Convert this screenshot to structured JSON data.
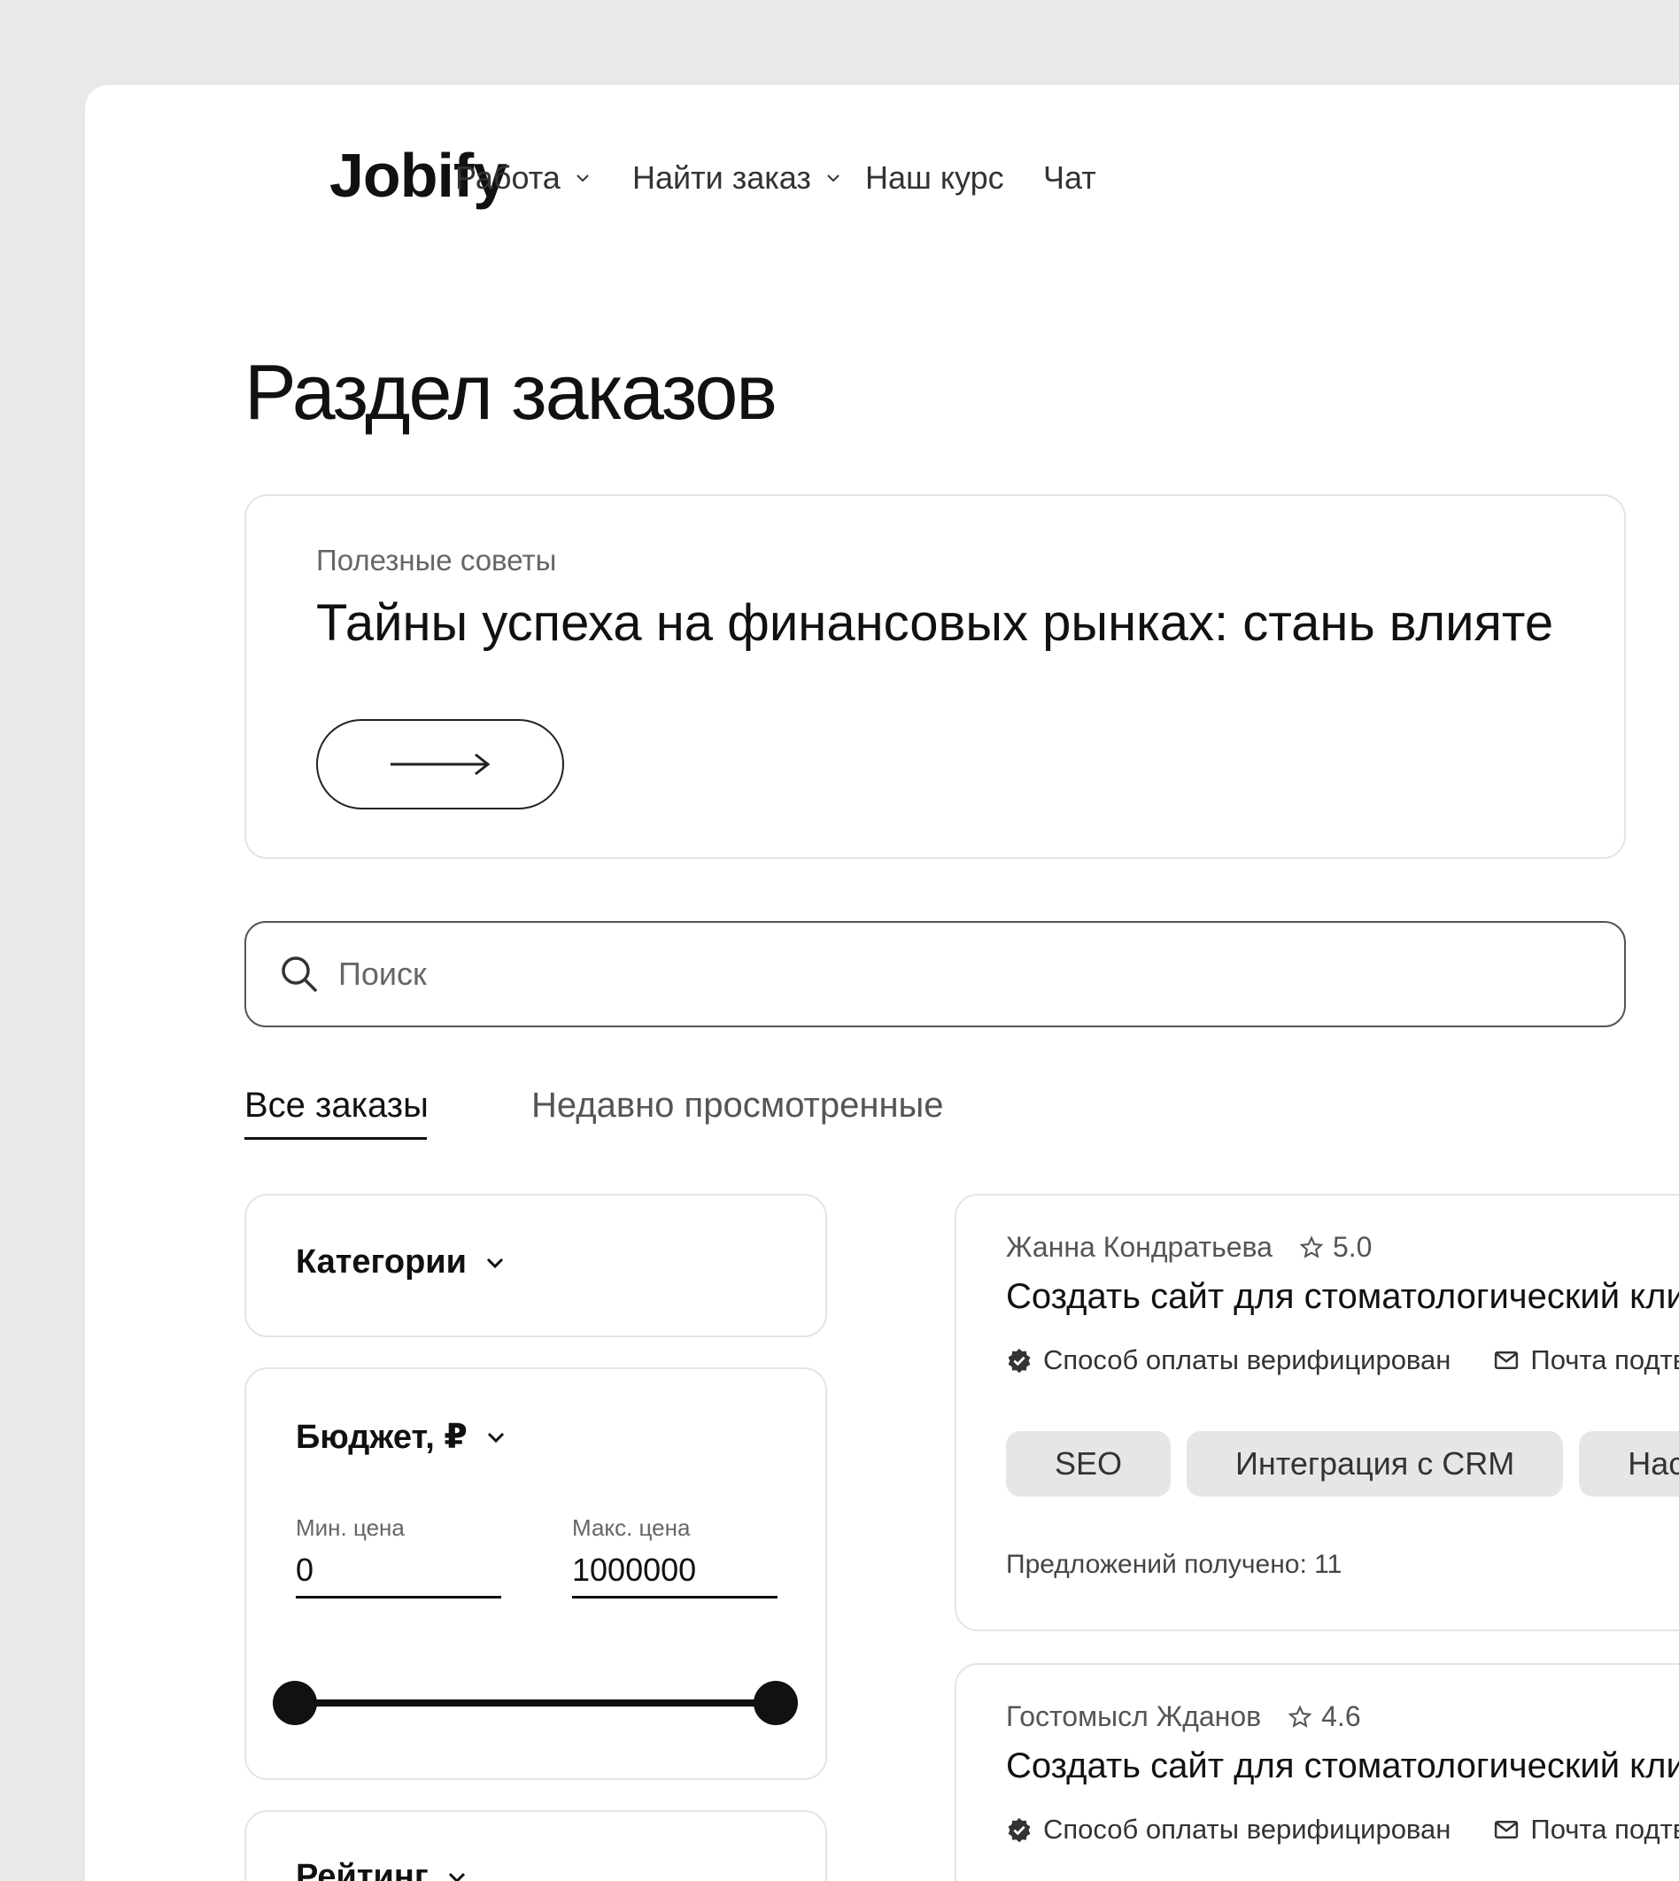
{
  "header": {
    "logo": "Jobify",
    "nav": [
      {
        "label": "Работа",
        "has_dropdown": true
      },
      {
        "label": "Найти заказ",
        "has_dropdown": true
      },
      {
        "label": "Наш курс",
        "has_dropdown": false
      },
      {
        "label": "Чат",
        "has_dropdown": false
      }
    ]
  },
  "page_title": "Раздел заказов",
  "tips": {
    "label": "Полезные советы",
    "headline": "Тайны успеха на финансовых рынках: стань влияте",
    "arrow_icon": "arrow-right-icon"
  },
  "search": {
    "placeholder": "Поиск",
    "value": ""
  },
  "tabs": [
    {
      "label": "Все заказы",
      "active": true
    },
    {
      "label": "Недавно просмотренные",
      "active": false
    }
  ],
  "filters": {
    "categories_title": "Категории",
    "budget_title": "Бюджет, ₽",
    "min_label": "Мин. цена",
    "min_value": "0",
    "max_label": "Макс. цена",
    "max_value": "1000000",
    "rating_title": "Рейтинг"
  },
  "orders": [
    {
      "author": "Жанна Кондратьева",
      "rating": "5.0",
      "title": "Создать сайт для стоматологический кли",
      "payment_verified": "Способ оплаты верифицирован",
      "email_verified": "Почта подтв",
      "tags": [
        "SEO",
        "Интеграция с CRM",
        "Нас"
      ],
      "proposals": "Предложений получено: 11"
    },
    {
      "author": "Гостомысл Жданов",
      "rating": "4.6",
      "title": "Создать сайт для стоматологический кли",
      "payment_verified": "Способ оплаты верифицирован",
      "email_verified": "Почта подтв"
    }
  ],
  "colors": {
    "page_bg": "#e9e9e9",
    "card_border": "#e4e4e4",
    "tag_bg": "#e6e6e6",
    "text": "#111111"
  }
}
